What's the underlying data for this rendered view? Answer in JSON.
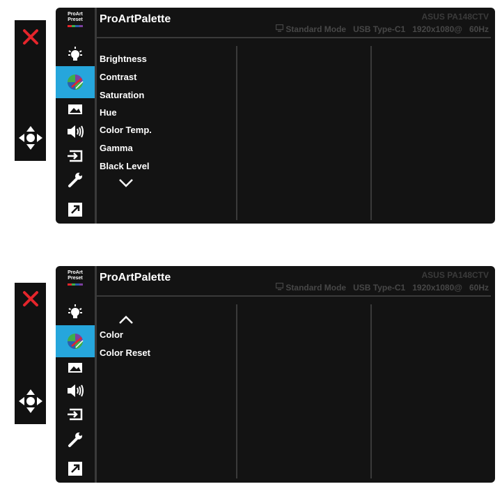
{
  "panels": [
    {
      "brand": {
        "line1": "ProArt",
        "line2": "Preset"
      },
      "title": "ProArtPalette",
      "model": "ASUS PA148CTV",
      "status": {
        "mode": "Standard Mode",
        "input": "USB Type-C1",
        "resolution": "1920x1080@",
        "refresh": "60Hz"
      },
      "menu": [
        "Brightness",
        "Contrast",
        "Saturation",
        "Hue",
        "Color Temp.",
        "Gamma",
        "Black Level"
      ],
      "scroll_arrow": "down"
    },
    {
      "brand": {
        "line1": "ProArt",
        "line2": "Preset"
      },
      "title": "ProArtPalette",
      "model": "ASUS PA148CTV",
      "status": {
        "mode": "Standard Mode",
        "input": "USB Type-C1",
        "resolution": "1920x1080@",
        "refresh": "60Hz"
      },
      "menu": [
        "Color",
        "Color Reset"
      ],
      "scroll_arrow": "up"
    }
  ],
  "sidebar_icons": [
    "blue-light-filter-icon",
    "proart-palette-icon",
    "image-icon",
    "sound-icon",
    "input-select-icon",
    "system-setup-icon",
    "shortcut-icon"
  ],
  "key_icons": [
    "close-icon",
    "five-way-navigation-icon"
  ],
  "colors": {
    "highlight": "#26a6dc",
    "close_red": "#e4252b",
    "background": "#131313",
    "rgb": [
      "#e4252b",
      "#3fae49",
      "#2a5db0",
      "#7a3fa0"
    ]
  }
}
